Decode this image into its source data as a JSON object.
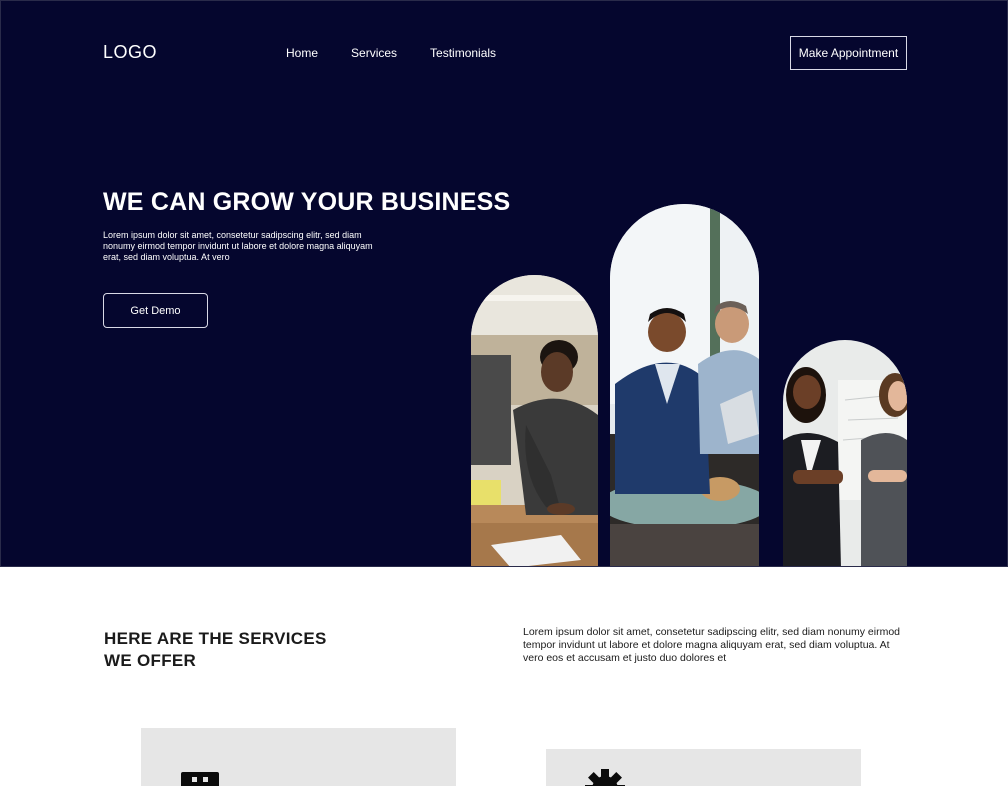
{
  "header": {
    "logo": "LOGO",
    "nav": [
      "Home",
      "Services",
      "Testimonials"
    ],
    "cta_label": "Make Appointment"
  },
  "hero": {
    "title": "WE CAN GROW YOUR BUSINESS",
    "description": "Lorem ipsum dolor sit amet, consetetur sadipscing elitr, sed diam nonumy eirmod tempor invidunt ut labore et dolore magna aliquyam erat, sed diam voluptua. At vero",
    "button_label": "Get Demo"
  },
  "services": {
    "title_line1": "HERE ARE THE SERVICES",
    "title_line2": "WE OFFER",
    "description": "Lorem ipsum dolor sit amet, consetetur sadipscing elitr, sed diam nonumy eirmod tempor invidunt ut labore et dolore magna aliquyam erat, sed diam voluptua. At vero eos et accusam et justo duo dolores et",
    "cards": [
      {
        "icon": "storefront-icon"
      },
      {
        "icon": "gear-icon"
      }
    ]
  },
  "colors": {
    "hero_bg": "#05062e",
    "card_bg": "#e6e6e6",
    "text_dark": "#1b1b1b"
  }
}
